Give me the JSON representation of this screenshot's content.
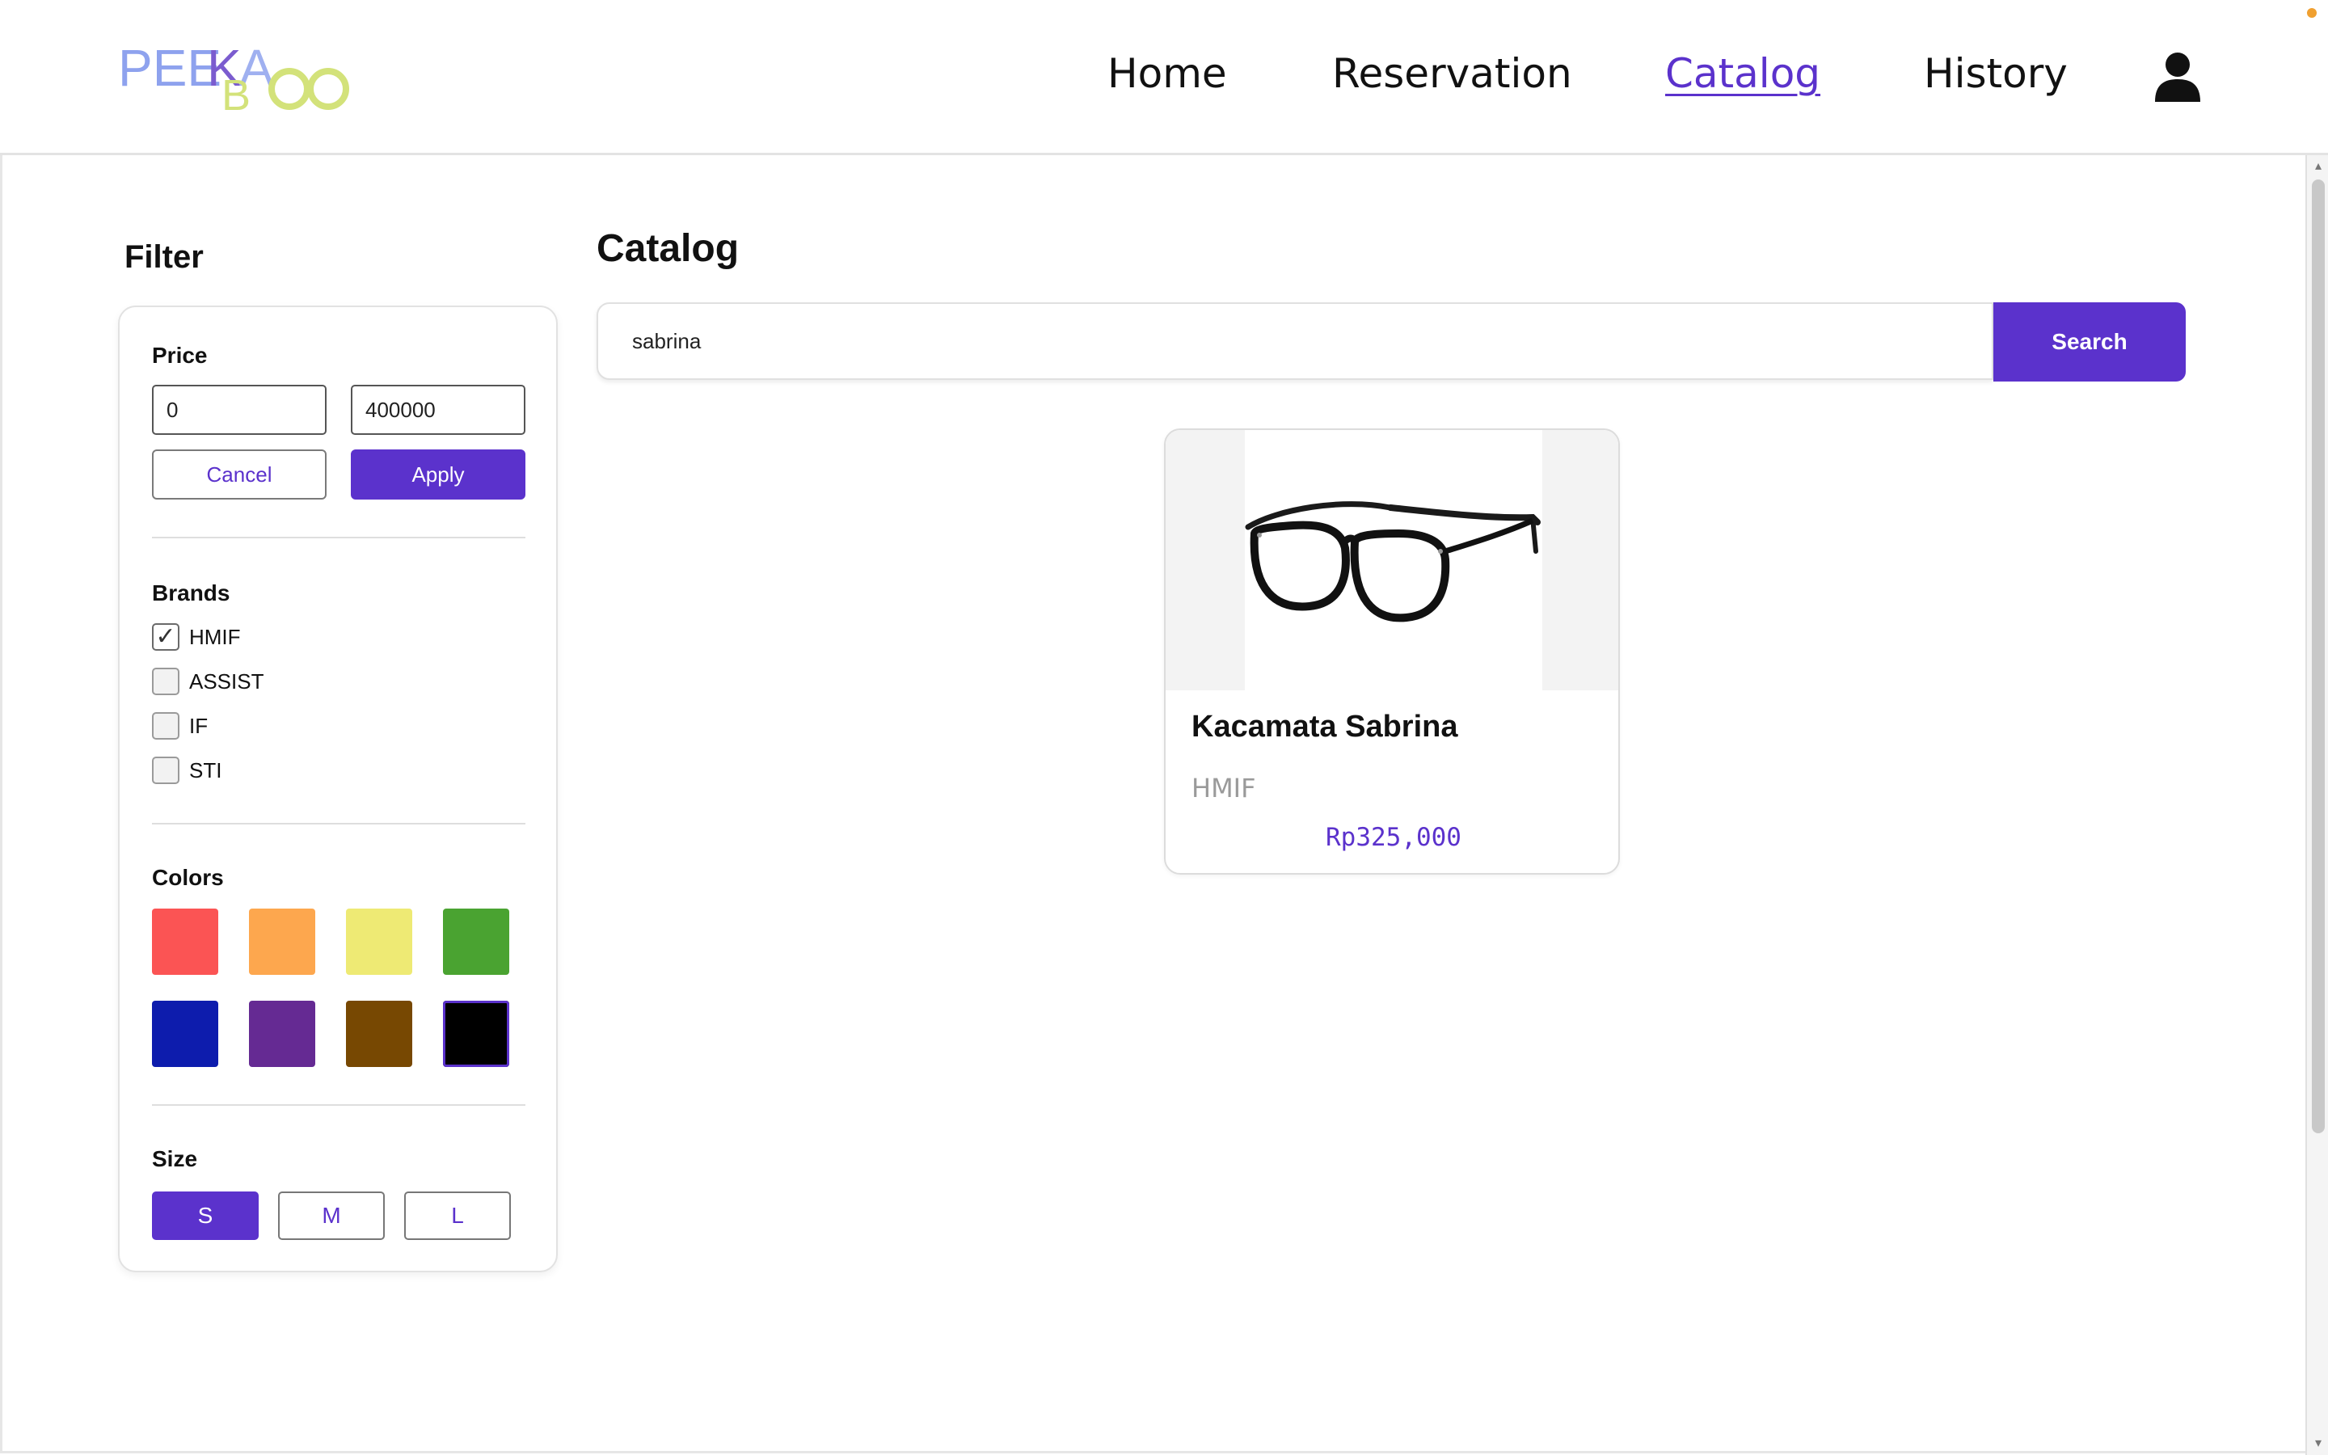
{
  "header": {
    "logo_text": "PEEKABOO",
    "nav": {
      "home": "Home",
      "reservation": "Reservation",
      "catalog": "Catalog",
      "history": "History"
    },
    "active_nav": "Catalog",
    "user_icon": "user-icon"
  },
  "filter": {
    "title": "Filter",
    "price": {
      "label": "Price",
      "min_value": "0",
      "max_value": "400000",
      "cancel_label": "Cancel",
      "apply_label": "Apply"
    },
    "brands": {
      "label": "Brands",
      "items": [
        {
          "name": "HMIF",
          "checked": true
        },
        {
          "name": "ASSIST",
          "checked": false
        },
        {
          "name": "IF",
          "checked": false
        },
        {
          "name": "STI",
          "checked": false
        }
      ]
    },
    "colors": {
      "label": "Colors",
      "swatches": [
        "#fb5454",
        "#fda74e",
        "#eeea74",
        "#4aa331",
        "#0d1cad",
        "#652a93",
        "#774802",
        "#000000"
      ],
      "selected": "#000000"
    },
    "size": {
      "label": "Size",
      "options": [
        "S",
        "M",
        "L"
      ],
      "selected": "S"
    }
  },
  "catalog": {
    "title": "Catalog",
    "search": {
      "value": "sabrina",
      "button_label": "Search"
    },
    "products": [
      {
        "name": "Kacamata Sabrina",
        "brand": "HMIF",
        "price": "Rp325,000",
        "image": "glasses-image"
      }
    ]
  },
  "colors": {
    "accent": "#5b32cc",
    "logo_blue": "#8ea2ee",
    "logo_purple": "#7b5ccf",
    "logo_green": "#d3e27a"
  }
}
